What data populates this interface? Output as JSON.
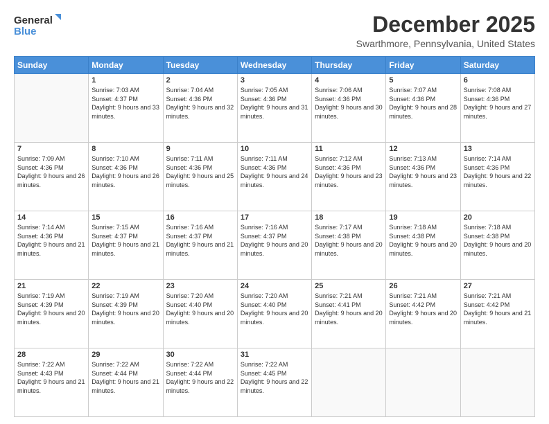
{
  "logo": {
    "general": "General",
    "blue": "Blue"
  },
  "title": "December 2025",
  "subtitle": "Swarthmore, Pennsylvania, United States",
  "weekdays": [
    "Sunday",
    "Monday",
    "Tuesday",
    "Wednesday",
    "Thursday",
    "Friday",
    "Saturday"
  ],
  "weeks": [
    [
      {
        "day": "",
        "sunrise": "",
        "sunset": "",
        "daylight": ""
      },
      {
        "day": "1",
        "sunrise": "Sunrise: 7:03 AM",
        "sunset": "Sunset: 4:37 PM",
        "daylight": "Daylight: 9 hours and 33 minutes."
      },
      {
        "day": "2",
        "sunrise": "Sunrise: 7:04 AM",
        "sunset": "Sunset: 4:36 PM",
        "daylight": "Daylight: 9 hours and 32 minutes."
      },
      {
        "day": "3",
        "sunrise": "Sunrise: 7:05 AM",
        "sunset": "Sunset: 4:36 PM",
        "daylight": "Daylight: 9 hours and 31 minutes."
      },
      {
        "day": "4",
        "sunrise": "Sunrise: 7:06 AM",
        "sunset": "Sunset: 4:36 PM",
        "daylight": "Daylight: 9 hours and 30 minutes."
      },
      {
        "day": "5",
        "sunrise": "Sunrise: 7:07 AM",
        "sunset": "Sunset: 4:36 PM",
        "daylight": "Daylight: 9 hours and 28 minutes."
      },
      {
        "day": "6",
        "sunrise": "Sunrise: 7:08 AM",
        "sunset": "Sunset: 4:36 PM",
        "daylight": "Daylight: 9 hours and 27 minutes."
      }
    ],
    [
      {
        "day": "7",
        "sunrise": "Sunrise: 7:09 AM",
        "sunset": "Sunset: 4:36 PM",
        "daylight": "Daylight: 9 hours and 26 minutes."
      },
      {
        "day": "8",
        "sunrise": "Sunrise: 7:10 AM",
        "sunset": "Sunset: 4:36 PM",
        "daylight": "Daylight: 9 hours and 26 minutes."
      },
      {
        "day": "9",
        "sunrise": "Sunrise: 7:11 AM",
        "sunset": "Sunset: 4:36 PM",
        "daylight": "Daylight: 9 hours and 25 minutes."
      },
      {
        "day": "10",
        "sunrise": "Sunrise: 7:11 AM",
        "sunset": "Sunset: 4:36 PM",
        "daylight": "Daylight: 9 hours and 24 minutes."
      },
      {
        "day": "11",
        "sunrise": "Sunrise: 7:12 AM",
        "sunset": "Sunset: 4:36 PM",
        "daylight": "Daylight: 9 hours and 23 minutes."
      },
      {
        "day": "12",
        "sunrise": "Sunrise: 7:13 AM",
        "sunset": "Sunset: 4:36 PM",
        "daylight": "Daylight: 9 hours and 23 minutes."
      },
      {
        "day": "13",
        "sunrise": "Sunrise: 7:14 AM",
        "sunset": "Sunset: 4:36 PM",
        "daylight": "Daylight: 9 hours and 22 minutes."
      }
    ],
    [
      {
        "day": "14",
        "sunrise": "Sunrise: 7:14 AM",
        "sunset": "Sunset: 4:36 PM",
        "daylight": "Daylight: 9 hours and 21 minutes."
      },
      {
        "day": "15",
        "sunrise": "Sunrise: 7:15 AM",
        "sunset": "Sunset: 4:37 PM",
        "daylight": "Daylight: 9 hours and 21 minutes."
      },
      {
        "day": "16",
        "sunrise": "Sunrise: 7:16 AM",
        "sunset": "Sunset: 4:37 PM",
        "daylight": "Daylight: 9 hours and 21 minutes."
      },
      {
        "day": "17",
        "sunrise": "Sunrise: 7:16 AM",
        "sunset": "Sunset: 4:37 PM",
        "daylight": "Daylight: 9 hours and 20 minutes."
      },
      {
        "day": "18",
        "sunrise": "Sunrise: 7:17 AM",
        "sunset": "Sunset: 4:38 PM",
        "daylight": "Daylight: 9 hours and 20 minutes."
      },
      {
        "day": "19",
        "sunrise": "Sunrise: 7:18 AM",
        "sunset": "Sunset: 4:38 PM",
        "daylight": "Daylight: 9 hours and 20 minutes."
      },
      {
        "day": "20",
        "sunrise": "Sunrise: 7:18 AM",
        "sunset": "Sunset: 4:38 PM",
        "daylight": "Daylight: 9 hours and 20 minutes."
      }
    ],
    [
      {
        "day": "21",
        "sunrise": "Sunrise: 7:19 AM",
        "sunset": "Sunset: 4:39 PM",
        "daylight": "Daylight: 9 hours and 20 minutes."
      },
      {
        "day": "22",
        "sunrise": "Sunrise: 7:19 AM",
        "sunset": "Sunset: 4:39 PM",
        "daylight": "Daylight: 9 hours and 20 minutes."
      },
      {
        "day": "23",
        "sunrise": "Sunrise: 7:20 AM",
        "sunset": "Sunset: 4:40 PM",
        "daylight": "Daylight: 9 hours and 20 minutes."
      },
      {
        "day": "24",
        "sunrise": "Sunrise: 7:20 AM",
        "sunset": "Sunset: 4:40 PM",
        "daylight": "Daylight: 9 hours and 20 minutes."
      },
      {
        "day": "25",
        "sunrise": "Sunrise: 7:21 AM",
        "sunset": "Sunset: 4:41 PM",
        "daylight": "Daylight: 9 hours and 20 minutes."
      },
      {
        "day": "26",
        "sunrise": "Sunrise: 7:21 AM",
        "sunset": "Sunset: 4:42 PM",
        "daylight": "Daylight: 9 hours and 20 minutes."
      },
      {
        "day": "27",
        "sunrise": "Sunrise: 7:21 AM",
        "sunset": "Sunset: 4:42 PM",
        "daylight": "Daylight: 9 hours and 21 minutes."
      }
    ],
    [
      {
        "day": "28",
        "sunrise": "Sunrise: 7:22 AM",
        "sunset": "Sunset: 4:43 PM",
        "daylight": "Daylight: 9 hours and 21 minutes."
      },
      {
        "day": "29",
        "sunrise": "Sunrise: 7:22 AM",
        "sunset": "Sunset: 4:44 PM",
        "daylight": "Daylight: 9 hours and 21 minutes."
      },
      {
        "day": "30",
        "sunrise": "Sunrise: 7:22 AM",
        "sunset": "Sunset: 4:44 PM",
        "daylight": "Daylight: 9 hours and 22 minutes."
      },
      {
        "day": "31",
        "sunrise": "Sunrise: 7:22 AM",
        "sunset": "Sunset: 4:45 PM",
        "daylight": "Daylight: 9 hours and 22 minutes."
      },
      {
        "day": "",
        "sunrise": "",
        "sunset": "",
        "daylight": ""
      },
      {
        "day": "",
        "sunrise": "",
        "sunset": "",
        "daylight": ""
      },
      {
        "day": "",
        "sunrise": "",
        "sunset": "",
        "daylight": ""
      }
    ]
  ]
}
